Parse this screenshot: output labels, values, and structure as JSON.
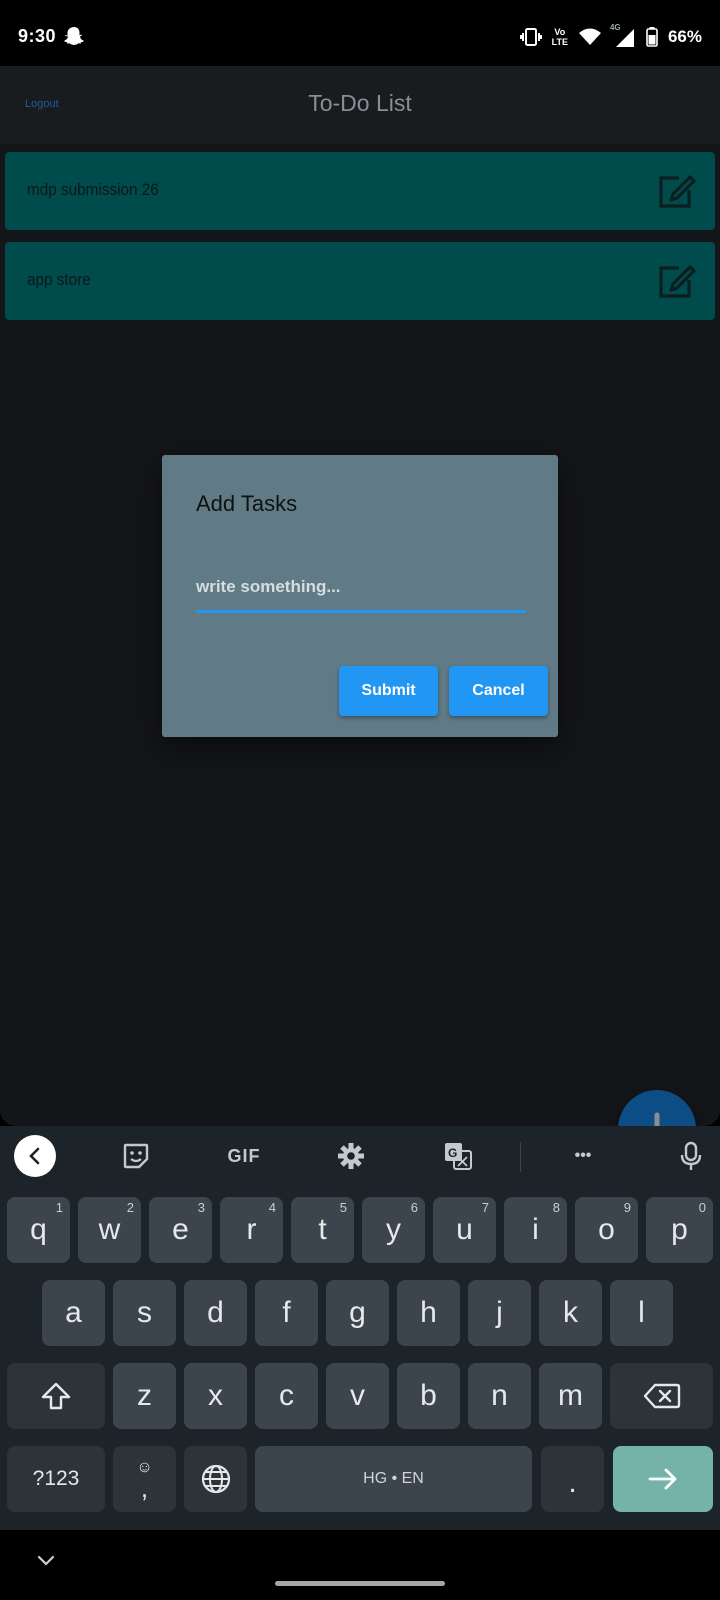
{
  "status_bar": {
    "time": "9:30",
    "battery_percent": "66%",
    "network_label": "4G",
    "volte_label_top": "Vo",
    "volte_label_bottom": "LTE"
  },
  "app_bar": {
    "logout_label": "Logout",
    "title": "To-Do List"
  },
  "tasks": [
    {
      "text": "mdp submission 26"
    },
    {
      "text": "app store"
    }
  ],
  "dialog": {
    "title": "Add Tasks",
    "input_placeholder": "write something...",
    "input_value": "",
    "submit_label": "Submit",
    "cancel_label": "Cancel"
  },
  "keyboard": {
    "toolbar": {
      "gif_label": "GIF",
      "more_label": "•••"
    },
    "row1": [
      {
        "label": "q",
        "hint": "1"
      },
      {
        "label": "w",
        "hint": "2"
      },
      {
        "label": "e",
        "hint": "3"
      },
      {
        "label": "r",
        "hint": "4"
      },
      {
        "label": "t",
        "hint": "5"
      },
      {
        "label": "y",
        "hint": "6"
      },
      {
        "label": "u",
        "hint": "7"
      },
      {
        "label": "i",
        "hint": "8"
      },
      {
        "label": "o",
        "hint": "9"
      },
      {
        "label": "p",
        "hint": "0"
      }
    ],
    "row2": [
      {
        "label": "a"
      },
      {
        "label": "s"
      },
      {
        "label": "d"
      },
      {
        "label": "f"
      },
      {
        "label": "g"
      },
      {
        "label": "h"
      },
      {
        "label": "j"
      },
      {
        "label": "k"
      },
      {
        "label": "l"
      }
    ],
    "row3": [
      {
        "label": "z"
      },
      {
        "label": "x"
      },
      {
        "label": "c"
      },
      {
        "label": "v"
      },
      {
        "label": "b"
      },
      {
        "label": "n"
      },
      {
        "label": "m"
      }
    ],
    "symbols_label": "?123",
    "comma_label": ",",
    "emoji_glyph": "☺",
    "space_label": "HG • EN",
    "period_label": "."
  },
  "colors": {
    "task_card": "#004c4c",
    "dialog_bg": "#607b86",
    "button_blue": "#2196f3",
    "fab": "#0c4d85",
    "enter_key": "#75b3aa"
  }
}
